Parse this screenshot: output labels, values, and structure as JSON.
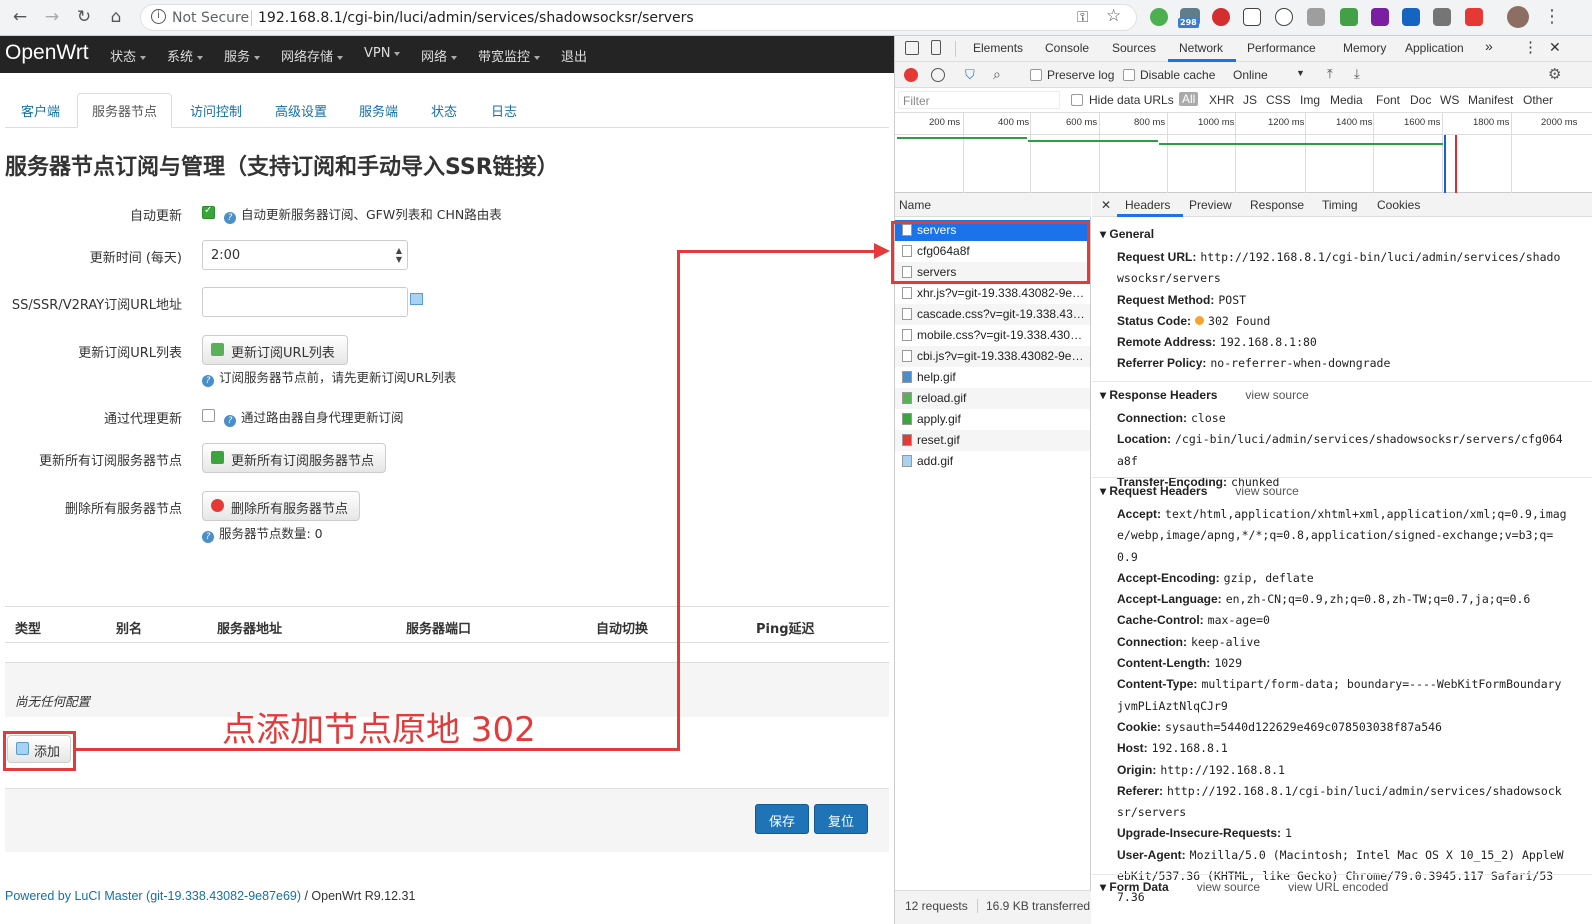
{
  "browser": {
    "url_security": "Not Secure",
    "url": "192.168.8.1/cgi-bin/luci/admin/services/shadowsocksr/servers",
    "ext_badge": "298"
  },
  "app": {
    "brand": "OpenWrt",
    "menu": [
      "状态",
      "系统",
      "服务",
      "网络存储",
      "VPN",
      "网络",
      "带宽监控"
    ],
    "logout": "退出",
    "tabs": [
      "客户端",
      "服务器节点",
      "访问控制",
      "高级设置",
      "服务端",
      "状态",
      "日志"
    ],
    "page_title": "服务器节点订阅与管理（支持订阅和手动导入SSR链接）",
    "form": {
      "auto_update": {
        "label": "自动更新",
        "checked": true,
        "desc": "自动更新服务器订阅、GFW列表和 CHN路由表"
      },
      "update_time": {
        "label": "更新时间 (每天)",
        "value": "2:00"
      },
      "sub_url": {
        "label": "SS/SSR/V2RAY订阅URL地址",
        "value": ""
      },
      "update_url_list": {
        "label": "更新订阅URL列表",
        "button": "更新订阅URL列表",
        "desc": "订阅服务器节点前，请先更新订阅URL列表"
      },
      "proxy_update": {
        "label": "通过代理更新",
        "checked": false,
        "desc": "通过路由器自身代理更新订阅"
      },
      "update_all": {
        "label": "更新所有订阅服务器节点",
        "button": "更新所有订阅服务器节点"
      },
      "delete_all": {
        "label": "删除所有服务器节点",
        "button": "删除所有服务器节点",
        "desc": "服务器节点数量: 0"
      }
    },
    "table": {
      "headers": [
        "类型",
        "别名",
        "服务器地址",
        "服务器端口",
        "自动切换",
        "Ping延迟"
      ],
      "empty": "尚无任何配置"
    },
    "add_button": "添加",
    "save_button": "保存",
    "reset_button": "复位",
    "footer_link": "Powered by LuCI Master (git-19.338.43082-9e87e69)",
    "footer_rest": " / OpenWrt R9.12.31",
    "annotation": "点添加节点原地 302",
    "colors": {
      "annotation": "#e13b3b",
      "primary": "#1f74b8"
    }
  },
  "devtools": {
    "tabs": [
      "Elements",
      "Console",
      "Sources",
      "Network",
      "Performance",
      "Memory",
      "Application"
    ],
    "active_tab": "Network",
    "toolbar": {
      "preserve_log": "Preserve log",
      "disable_cache": "Disable cache",
      "throttle": "Online"
    },
    "filter": {
      "placeholder": "Filter",
      "hide_data_urls": "Hide data URLs",
      "types": [
        "All",
        "XHR",
        "JS",
        "CSS",
        "Img",
        "Media",
        "Font",
        "Doc",
        "WS",
        "Manifest",
        "Other"
      ]
    },
    "ticks": [
      "200 ms",
      "400 ms",
      "600 ms",
      "800 ms",
      "1000 ms",
      "1200 ms",
      "1400 ms",
      "1600 ms",
      "1800 ms",
      "2000 ms"
    ],
    "name_header": "Name",
    "requests": [
      "servers",
      "cfg064a8f",
      "servers",
      "xhr.js?v=git-19.338.43082-9e…",
      "cascade.css?v=git-19.338.43…",
      "mobile.css?v=git-19.338.430…",
      "cbi.js?v=git-19.338.43082-9e…",
      "help.gif",
      "reload.gif",
      "apply.gif",
      "reset.gif",
      "add.gif"
    ],
    "status": {
      "requests": "12 requests",
      "transferred": "16.9 KB transferred"
    },
    "detail_tabs": [
      "Headers",
      "Preview",
      "Response",
      "Timing",
      "Cookies"
    ],
    "general": {
      "title": "General",
      "rows": [
        {
          "k": "Request URL:",
          "v": "http://192.168.8.1/cgi-bin/luci/admin/services/shadowsocksr/servers"
        },
        {
          "k": "Request Method:",
          "v": "POST"
        },
        {
          "k": "Status Code:",
          "v": "302 Found"
        },
        {
          "k": "Remote Address:",
          "v": "192.168.8.1:80"
        },
        {
          "k": "Referrer Policy:",
          "v": "no-referrer-when-downgrade"
        }
      ]
    },
    "response_headers": {
      "title": "Response Headers",
      "view_source": "view source",
      "rows": [
        {
          "k": "Connection:",
          "v": "close"
        },
        {
          "k": "Location:",
          "v": "/cgi-bin/luci/admin/services/shadowsocksr/servers/cfg064a8f"
        },
        {
          "k": "Transfer-Encoding:",
          "v": "chunked"
        }
      ]
    },
    "request_headers": {
      "title": "Request Headers",
      "view_source": "view source",
      "rows": [
        {
          "k": "Accept:",
          "v": "text/html,application/xhtml+xml,application/xml;q=0.9,image/webp,image/apng,*/*;q=0.8,application/signed-exchange;v=b3;q=0.9"
        },
        {
          "k": "Accept-Encoding:",
          "v": "gzip, deflate"
        },
        {
          "k": "Accept-Language:",
          "v": "en,zh-CN;q=0.9,zh;q=0.8,zh-TW;q=0.7,ja;q=0.6"
        },
        {
          "k": "Cache-Control:",
          "v": "max-age=0"
        },
        {
          "k": "Connection:",
          "v": "keep-alive"
        },
        {
          "k": "Content-Length:",
          "v": "1029"
        },
        {
          "k": "Content-Type:",
          "v": "multipart/form-data; boundary=----WebKitFormBoundaryjvmPLiAztNlqCJr9"
        },
        {
          "k": "Cookie:",
          "v": "sysauth=5440d122629e469c078503038f87a546"
        },
        {
          "k": "Host:",
          "v": "192.168.8.1"
        },
        {
          "k": "Origin:",
          "v": "http://192.168.8.1"
        },
        {
          "k": "Referer:",
          "v": "http://192.168.8.1/cgi-bin/luci/admin/services/shadowsocksr/servers"
        },
        {
          "k": "Upgrade-Insecure-Requests:",
          "v": "1"
        },
        {
          "k": "User-Agent:",
          "v": "Mozilla/5.0 (Macintosh; Intel Mac OS X 10_15_2) AppleWebKit/537.36 (KHTML, like Gecko) Chrome/79.0.3945.117 Safari/537.36"
        }
      ]
    },
    "form_data": {
      "title": "Form Data",
      "view_source": "view source",
      "view_url_encoded": "view URL encoded"
    }
  }
}
